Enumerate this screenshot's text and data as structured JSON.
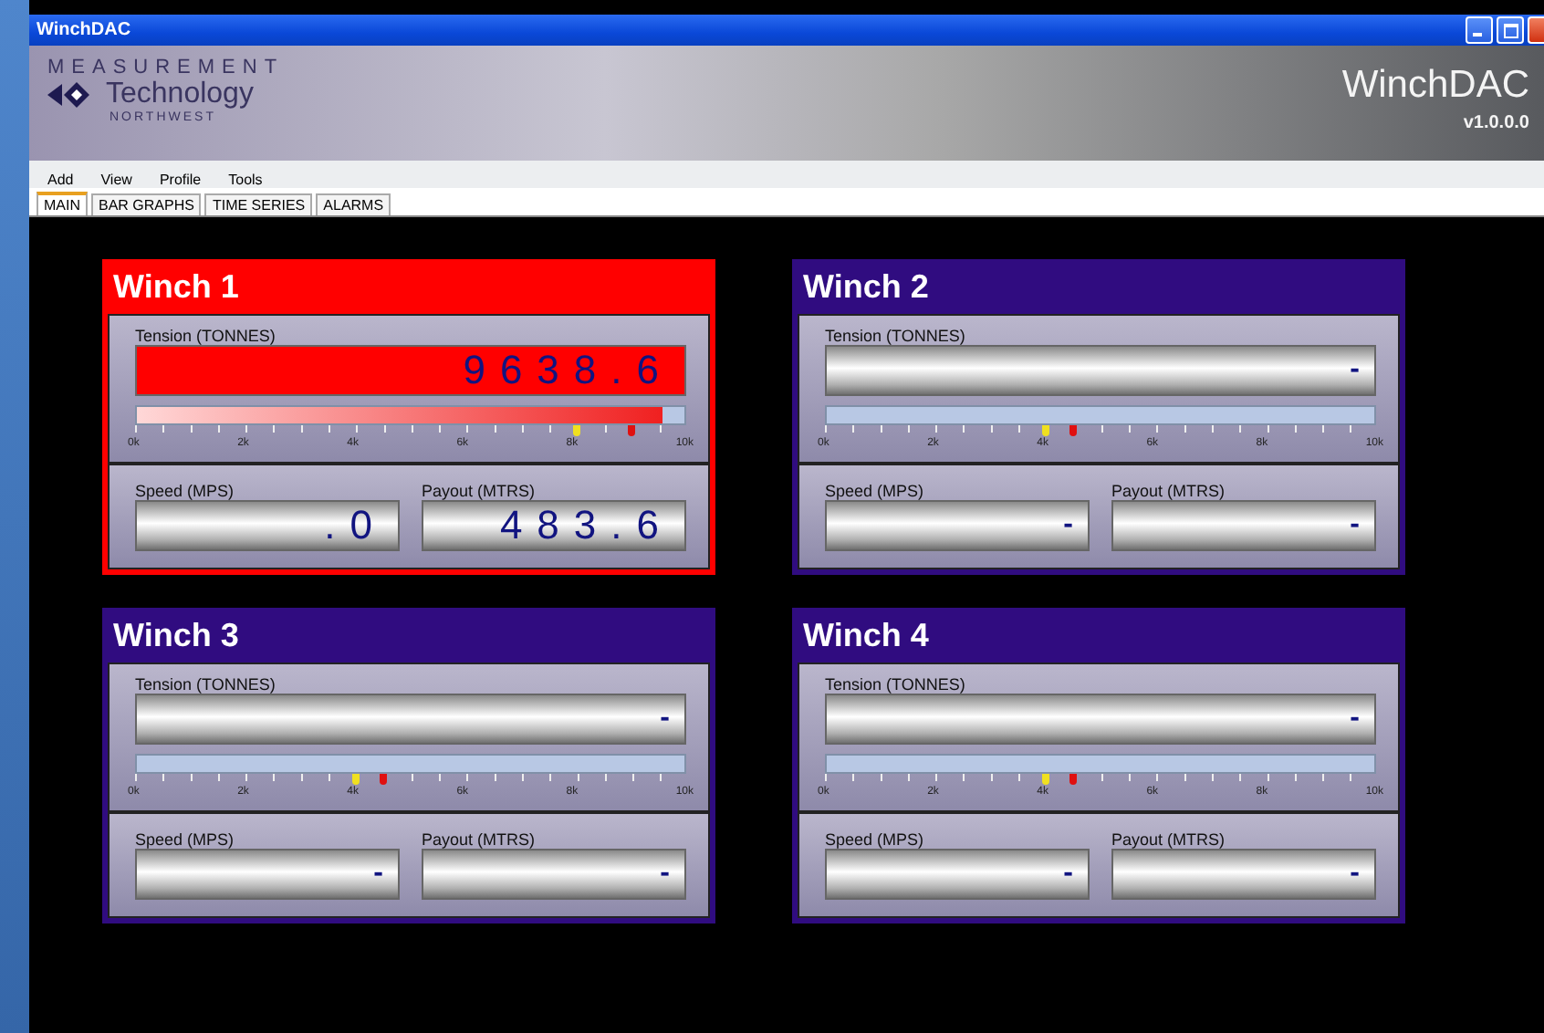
{
  "window": {
    "title": "WinchDAC"
  },
  "header": {
    "logo_top": "MEASUREMENT",
    "logo_main": "Technology",
    "logo_bottom": "NORTHWEST",
    "app_name": "WinchDAC",
    "version": "v1.0.0.0"
  },
  "menu": [
    "Add",
    "View",
    "Profile",
    "Tools"
  ],
  "tabs": [
    {
      "label": "MAIN",
      "selected": true
    },
    {
      "label": "BAR GRAPHS",
      "selected": false
    },
    {
      "label": "TIME SERIES",
      "selected": false
    },
    {
      "label": "ALARMS",
      "selected": false
    }
  ],
  "winches": [
    {
      "title": "Winch 1",
      "alarm": true,
      "tension": {
        "label": "Tension (TONNES)",
        "value": "9638.6",
        "level": 0.96,
        "markers": [
          {
            "kind": "warning",
            "level": 0.8
          },
          {
            "kind": "alarm",
            "level": 0.9
          }
        ],
        "scale": [
          "0k",
          "2k",
          "4k",
          "6k",
          "8k",
          "10k"
        ]
      },
      "speed": {
        "label": "Speed (MPS)",
        "value": ".0"
      },
      "payout": {
        "label": "Payout (MTRS)",
        "value": "483.6"
      }
    },
    {
      "title": "Winch 2",
      "alarm": false,
      "tension": {
        "label": "Tension (TONNES)",
        "value": "-",
        "level": 0,
        "markers": [
          {
            "kind": "warning",
            "level": 0.4
          },
          {
            "kind": "alarm",
            "level": 0.45
          }
        ],
        "scale": [
          "0k",
          "2k",
          "4k",
          "6k",
          "8k",
          "10k"
        ]
      },
      "speed": {
        "label": "Speed (MPS)",
        "value": "-"
      },
      "payout": {
        "label": "Payout (MTRS)",
        "value": "-"
      }
    },
    {
      "title": "Winch 3",
      "alarm": false,
      "tension": {
        "label": "Tension (TONNES)",
        "value": "-",
        "level": 0,
        "markers": [
          {
            "kind": "warning",
            "level": 0.4
          },
          {
            "kind": "alarm",
            "level": 0.45
          }
        ],
        "scale": [
          "0k",
          "2k",
          "4k",
          "6k",
          "8k",
          "10k"
        ]
      },
      "speed": {
        "label": "Speed (MPS)",
        "value": "-"
      },
      "payout": {
        "label": "Payout (MTRS)",
        "value": "-"
      }
    },
    {
      "title": "Winch 4",
      "alarm": false,
      "tension": {
        "label": "Tension (TONNES)",
        "value": "-",
        "level": 0,
        "markers": [
          {
            "kind": "warning",
            "level": 0.4
          },
          {
            "kind": "alarm",
            "level": 0.45
          }
        ],
        "scale": [
          "0k",
          "2k",
          "4k",
          "6k",
          "8k",
          "10k"
        ]
      },
      "speed": {
        "label": "Speed (MPS)",
        "value": "-"
      },
      "payout": {
        "label": "Payout (MTRS)",
        "value": "-"
      }
    }
  ]
}
